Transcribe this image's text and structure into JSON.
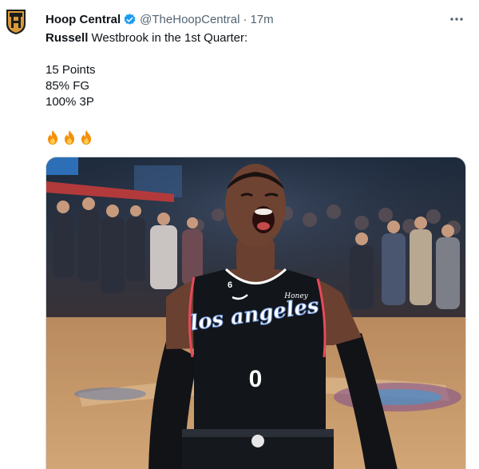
{
  "author": {
    "name": "Hoop Central",
    "handle": "@TheHoopCentral",
    "separator": "·",
    "time": "17m",
    "avatar_icon": "hoop-central-logo",
    "verified_icon": "verified-badge-icon"
  },
  "tweet": {
    "lines": [
      {
        "bold": "Russell",
        "rest": " Westbrook in the 1st Quarter:"
      },
      {
        "text": "15 Points"
      },
      {
        "text": "85% FG"
      },
      {
        "text": "100% 3P"
      }
    ],
    "emoji_count": 3,
    "emoji_icon": "fire-emoji-icon"
  },
  "media": {
    "jersey_number": "0",
    "jersey_side_number": "6",
    "jersey_script": "los angeles",
    "jersey_brand": "Honey"
  },
  "colors": {
    "text": "#0f1419",
    "secondary": "#536471",
    "verified": "#1d9bf0",
    "court": "#c89a6a"
  }
}
